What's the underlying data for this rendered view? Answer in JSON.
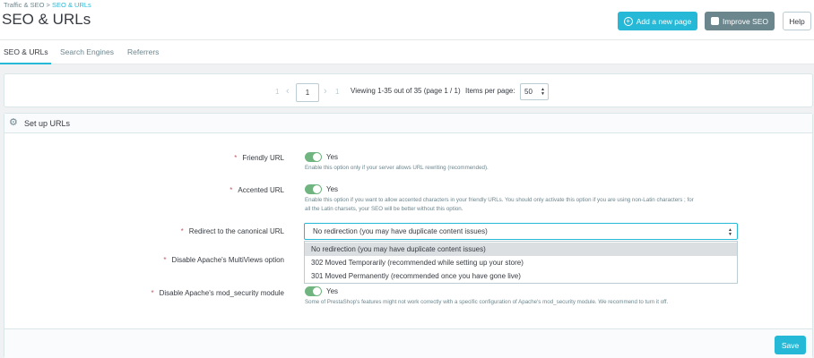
{
  "breadcrumb": {
    "parent": "Traffic & SEO",
    "separator": ">",
    "current": "SEO & URLs"
  },
  "page_title": "SEO & URLs",
  "toolbar": {
    "add_page": "Add a new page",
    "improve_seo": "Improve SEO",
    "help": "Help"
  },
  "tabs": [
    {
      "label": "SEO & URLs",
      "active": true
    },
    {
      "label": "Search Engines",
      "active": false
    },
    {
      "label": "Referrers",
      "active": false
    }
  ],
  "pagination": {
    "first": "1",
    "prev": "‹",
    "current_page": "1",
    "next": "›",
    "last": "1",
    "viewing": "Viewing 1-35 out of 35 (page 1 / 1)",
    "items_per_page_label": "Items per page:",
    "items_per_page_value": "50"
  },
  "setup_urls": {
    "title": "Set up URLs",
    "friendly_url": {
      "label": "Friendly URL",
      "value": "Yes",
      "help": "Enable this option only if your server allows URL rewriting (recommended)."
    },
    "accented_url": {
      "label": "Accented URL",
      "value": "Yes",
      "help_line1": "Enable this option if you want to allow accented characters in your friendly URLs. You should only activate this option if you are using non-Latin characters ; for",
      "help_line2": "all the Latin charsets, your SEO will be better without this option."
    },
    "redirect": {
      "label": "Redirect to the canonical URL",
      "selected": "No redirection (you may have duplicate content issues)",
      "options": [
        "No redirection (you may have duplicate content issues)",
        "302 Moved Temporarily (recommended while setting up your store)",
        "301 Moved Permanently (recommended once you have gone live)"
      ]
    },
    "multiviews": {
      "label": "Disable Apache's MultiViews option"
    },
    "mod_security": {
      "label": "Disable Apache's mod_security module",
      "value": "Yes",
      "help": "Some of PrestaShop's features might not work correctly with a specific configuration of Apache's mod_security module. We recommend to turn it off."
    },
    "save": "Save"
  },
  "colors": {
    "accent": "#25b9d7",
    "toggle_on": "#70b580",
    "required": "#c05c67"
  }
}
